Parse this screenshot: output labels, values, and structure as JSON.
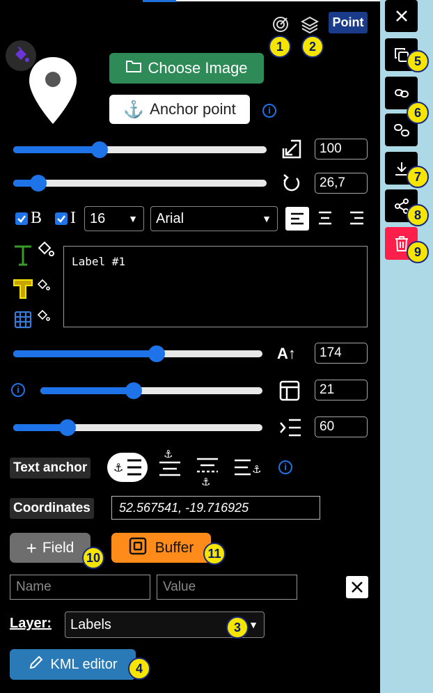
{
  "header": {
    "point_badge": "Point"
  },
  "buttons": {
    "choose_image": "Choose Image",
    "anchor_point": "Anchor point"
  },
  "sliders": {
    "size": {
      "value": "100",
      "level": 0.35
    },
    "rotation": {
      "value": "26,7",
      "level": 0.1
    },
    "font_height": {
      "value": "174",
      "level": 0.57
    },
    "box": {
      "value": "21",
      "level": 0.42
    },
    "indent": {
      "value": "60",
      "level": 0.22
    }
  },
  "font": {
    "bold_label": "B",
    "italic_label": "I",
    "size": "16",
    "family": "Arial",
    "bold_checked": true,
    "italic_checked": true
  },
  "label_text": "Label #1",
  "text_anchor": {
    "label": "Text anchor"
  },
  "coordinates": {
    "label": "Coordinates",
    "value": "52.567541, -19.716925"
  },
  "field_button": "Field",
  "buffer_button": "Buffer",
  "new_field": {
    "name_placeholder": "Name",
    "value_placeholder": "Value"
  },
  "layer": {
    "label": "Layer:",
    "value": "Labels"
  },
  "kml_editor": "KML editor",
  "annotations": [
    "1",
    "2",
    "3",
    "4",
    "5",
    "6",
    "7",
    "8",
    "9",
    "10",
    "11"
  ],
  "colors": {
    "accent": "#1e73e8",
    "green": "#2e8b57",
    "orange": "#ff8c1a",
    "danger": "#ff1f4b",
    "sidebar": "#add8e6",
    "badge": "#f5e500"
  }
}
